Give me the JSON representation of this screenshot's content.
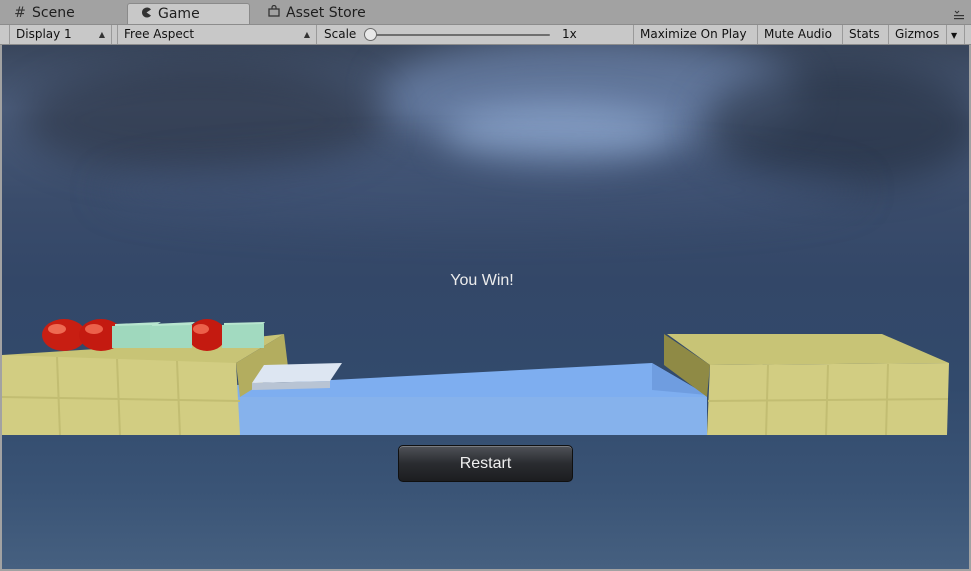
{
  "tabs": {
    "scene": "Scene",
    "game": "Game",
    "asset_store": "Asset Store"
  },
  "toolbar": {
    "display": "Display 1",
    "aspect": "Free Aspect",
    "scale_label": "Scale",
    "scale_value": "1x",
    "maximize": "Maximize On Play",
    "mute": "Mute Audio",
    "stats": "Stats",
    "gizmos": "Gizmos"
  },
  "game": {
    "message": "You Win!",
    "restart_label": "Restart"
  },
  "icons": {
    "scene": "grid-icon",
    "game": "pacman-icon",
    "asset_store": "store-bag-icon",
    "menu": "tab-menu-icon"
  }
}
